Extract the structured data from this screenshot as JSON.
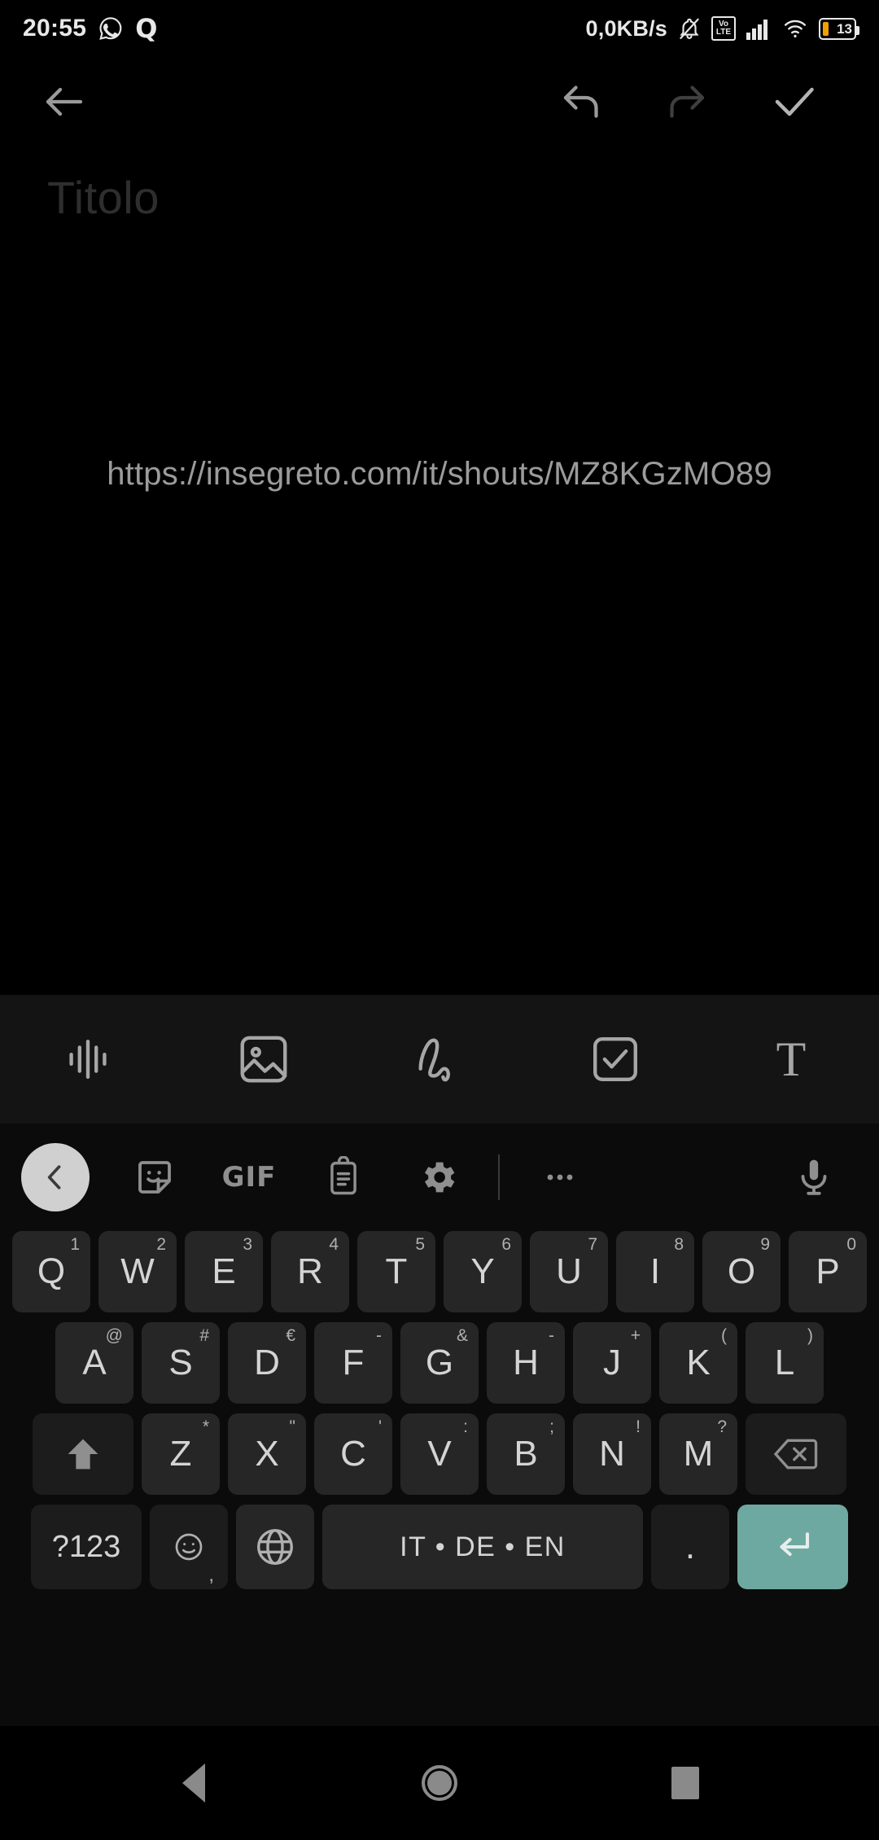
{
  "status_bar": {
    "time": "20:55",
    "network_speed": "0,0KB/s",
    "battery_level": "13",
    "icons": [
      "whatsapp-icon",
      "quora-icon",
      "notifications-muted-icon",
      "volte-icon",
      "cellular-signal-icon",
      "wifi-icon",
      "battery-icon"
    ],
    "volte_top": "Vo",
    "volte_bottom": "LTE"
  },
  "app_bar": {
    "back_label": "back-arrow",
    "undo_label": "undo",
    "redo_label": "redo",
    "done_label": "done-check"
  },
  "note": {
    "title_placeholder": "Titolo",
    "body_text": "https://insegreto.com/it/shouts/MZ8KGzMO89"
  },
  "editor_toolbar": {
    "items": [
      {
        "name": "audio-recording-icon",
        "label": "audio"
      },
      {
        "name": "image-icon",
        "label": "image"
      },
      {
        "name": "drawing-icon",
        "label": "drawing"
      },
      {
        "name": "checklist-icon",
        "label": "checklist"
      },
      {
        "name": "text-format-icon",
        "label": "T"
      }
    ]
  },
  "keyboard": {
    "toolbar": [
      {
        "name": "back-chevron-button",
        "label": "<"
      },
      {
        "name": "sticker-icon",
        "label": "sticker"
      },
      {
        "name": "gif-button",
        "label": "GIF"
      },
      {
        "name": "clipboard-icon",
        "label": "clipboard"
      },
      {
        "name": "settings-gear-icon",
        "label": "settings"
      },
      {
        "name": "more-options-icon",
        "label": "..."
      },
      {
        "name": "microphone-icon",
        "label": "mic"
      }
    ],
    "row1": [
      {
        "key": "Q",
        "sup": "1"
      },
      {
        "key": "W",
        "sup": "2"
      },
      {
        "key": "E",
        "sup": "3"
      },
      {
        "key": "R",
        "sup": "4"
      },
      {
        "key": "T",
        "sup": "5"
      },
      {
        "key": "Y",
        "sup": "6"
      },
      {
        "key": "U",
        "sup": "7"
      },
      {
        "key": "I",
        "sup": "8"
      },
      {
        "key": "O",
        "sup": "9"
      },
      {
        "key": "P",
        "sup": "0"
      }
    ],
    "row2": [
      {
        "key": "A",
        "sup": "@"
      },
      {
        "key": "S",
        "sup": "#"
      },
      {
        "key": "D",
        "sup": "€"
      },
      {
        "key": "F",
        "sup": "-"
      },
      {
        "key": "G",
        "sup": "&"
      },
      {
        "key": "H",
        "sup": "-"
      },
      {
        "key": "J",
        "sup": "+"
      },
      {
        "key": "K",
        "sup": "("
      },
      {
        "key": "L",
        "sup": ")"
      }
    ],
    "row3": [
      {
        "key": "Z",
        "sup": "*"
      },
      {
        "key": "X",
        "sup": "\""
      },
      {
        "key": "C",
        "sup": "'"
      },
      {
        "key": "V",
        "sup": ":"
      },
      {
        "key": "B",
        "sup": ";"
      },
      {
        "key": "N",
        "sup": "!"
      },
      {
        "key": "M",
        "sup": "?"
      }
    ],
    "shift_label": "shift",
    "backspace_label": "backspace",
    "symbols_label": "?123",
    "emoji_label": "emoji",
    "emoji_sub": ",",
    "globe_label": "language-globe",
    "space_label": "IT • DE • EN",
    "period_label": ".",
    "enter_label": "enter",
    "enter_color": "#6ea9a1"
  },
  "nav_bar": {
    "back_label": "back",
    "home_label": "home",
    "recents_label": "recents"
  }
}
